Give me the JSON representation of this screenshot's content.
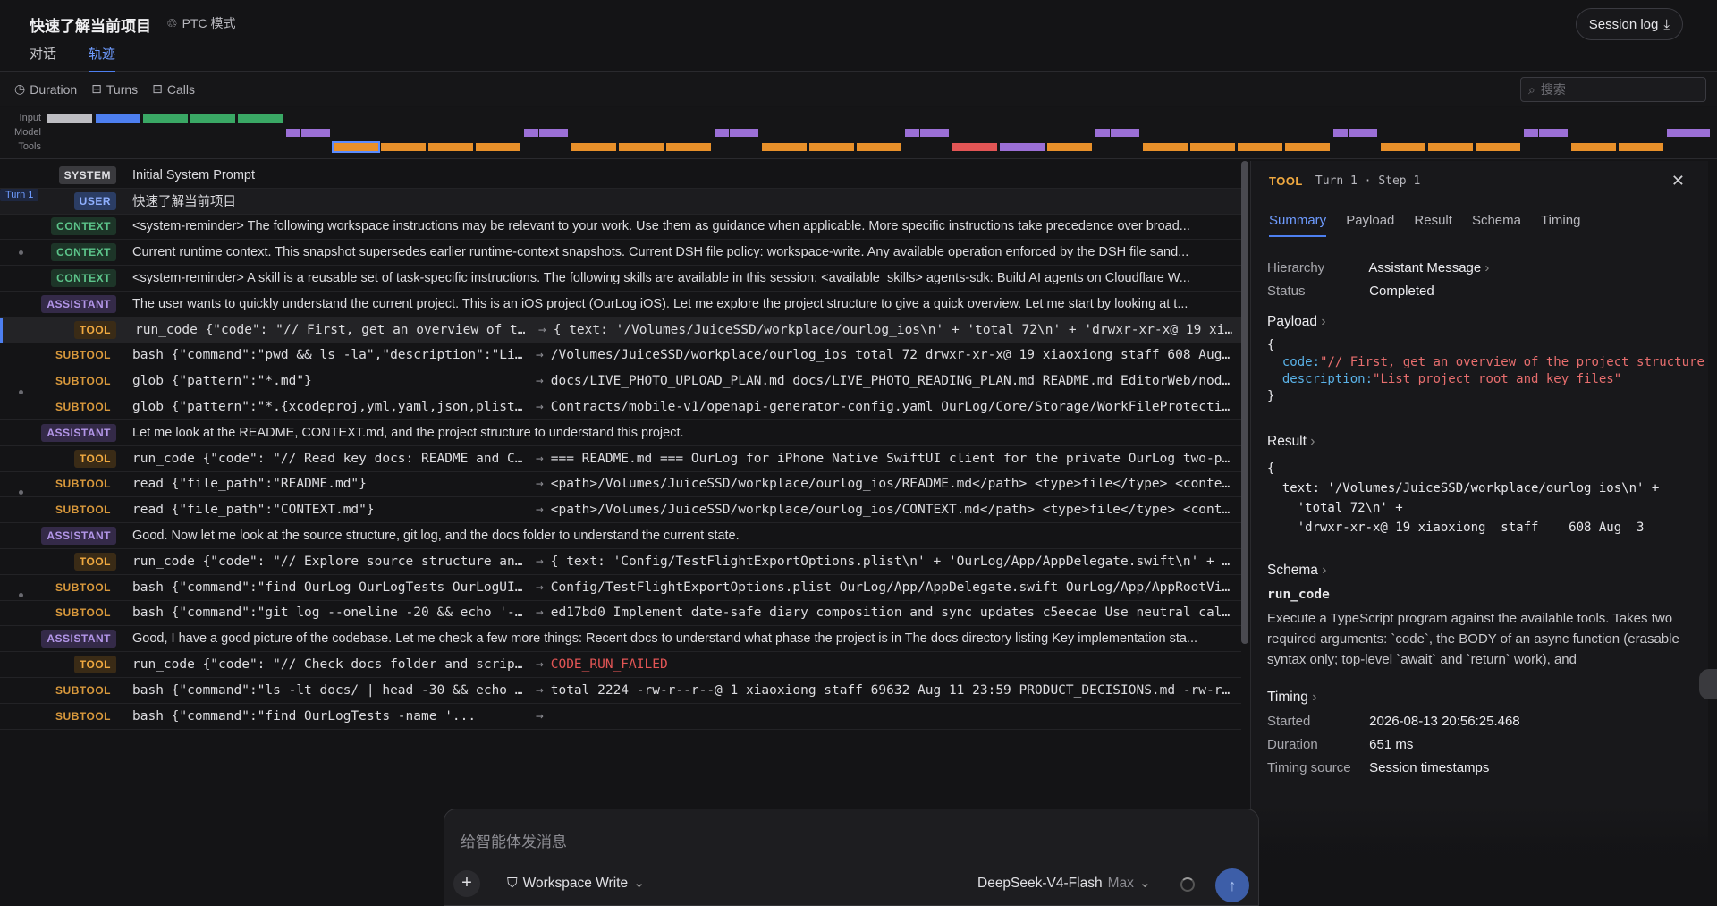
{
  "header": {
    "title": "快速了解当前项目",
    "mode": "PTC 模式",
    "tabs": [
      "对话",
      "轨迹"
    ],
    "session_log": "Session log"
  },
  "filters": {
    "duration": "Duration",
    "turns": "Turns",
    "calls": "Calls",
    "search_placeholder": "搜索"
  },
  "timeline": {
    "labels": [
      "Input",
      "Model",
      "Tools"
    ]
  },
  "turn_label": "Turn 1",
  "rows": [
    {
      "badge": "SYSTEM",
      "kind": "system",
      "text": "Initial System Prompt"
    },
    {
      "badge": "USER",
      "kind": "user",
      "text": "快速了解当前项目"
    },
    {
      "badge": "CONTEXT",
      "kind": "context",
      "text": "<system-reminder> The following workspace instructions may be relevant to your work. Use them as guidance when applicable. More specific instructions take precedence over broad..."
    },
    {
      "badge": "CONTEXT",
      "kind": "context",
      "text": "Current runtime context. This snapshot supersedes earlier runtime-context snapshots. Current DSH file policy: workspace-write. Any available operation enforced by the DSH file sand..."
    },
    {
      "badge": "CONTEXT",
      "kind": "context",
      "text": "<system-reminder> A skill is a reusable set of task-specific instructions. The following skills are available in this session: <available_skills> agents-sdk: Build AI agents on Cloudflare W..."
    },
    {
      "badge": "ASSISTANT",
      "kind": "assistant",
      "text": "The user wants to quickly understand the current project. This is an iOS project (OurLog iOS). Let me explore the project structure to give a quick overview. Let me start by looking at t..."
    },
    {
      "badge": "TOOL",
      "kind": "tool",
      "args": "run_code {\"code\": \"// First, get an overview of th...",
      "result": "{ text: '/Volumes/JuiceSSD/workplace/ourlog_ios\\n' + 'total 72\\n' + 'drwxr-xr-x@ 19 xiaox..."
    },
    {
      "badge": "SUBTOOL",
      "kind": "subtool",
      "args": "bash {\"command\":\"pwd && ls -la\",\"description\":\"Lis...",
      "result": "/Volumes/JuiceSSD/workplace/ourlog_ios total 72 drwxr-xr-x@ 19 xiaoxiong staff 608 Aug 3 ..."
    },
    {
      "badge": "SUBTOOL",
      "kind": "subtool",
      "args": "glob {\"pattern\":\"*.md\"}",
      "result": "docs/LIVE_PHOTO_UPLOAD_PLAN.md docs/LIVE_PHOTO_READING_PLAN.md README.md EditorWeb/node_m..."
    },
    {
      "badge": "SUBTOOL",
      "kind": "subtool",
      "args": "glob {\"pattern\":\"*.{xcodeproj,yml,yaml,json,plist,...",
      "result": "Contracts/mobile-v1/openapi-generator-config.yaml OurLog/Core/Storage/WorkFileProtection...."
    },
    {
      "badge": "ASSISTANT",
      "kind": "assistant",
      "text": "Let me look at the README, CONTEXT.md, and the project structure to understand this project."
    },
    {
      "badge": "TOOL",
      "kind": "tool",
      "args": "run_code {\"code\": \"// Read key docs: README and CO...",
      "result": "=== README.md === OurLog for iPhone Native SwiftUI client for the private OurLog two-pers..."
    },
    {
      "badge": "SUBTOOL",
      "kind": "subtool",
      "args": "read {\"file_path\":\"README.md\"}",
      "result": "<path>/Volumes/JuiceSSD/workplace/ourlog_ios/README.md</path> <type>file</type> <content>..."
    },
    {
      "badge": "SUBTOOL",
      "kind": "subtool",
      "args": "read {\"file_path\":\"CONTEXT.md\"}",
      "result": "<path>/Volumes/JuiceSSD/workplace/ourlog_ios/CONTEXT.md</path> <type>file</type> <content..."
    },
    {
      "badge": "ASSISTANT",
      "kind": "assistant",
      "text": "Good. Now let me look at the source structure, git log, and the docs folder to understand the current state."
    },
    {
      "badge": "TOOL",
      "kind": "tool",
      "args": "run_code {\"code\": \"// Explore source structure and...",
      "result": "{ text: 'Config/TestFlightExportOptions.plist\\n' + 'OurLog/App/AppDelegate.swift\\n' + 'Ou..."
    },
    {
      "badge": "SUBTOOL",
      "kind": "subtool",
      "args": "bash {\"command\":\"find OurLog OurLogTests OurLogUIT...",
      "result": "Config/TestFlightExportOptions.plist OurLog/App/AppDelegate.swift OurLog/App/AppRootView...."
    },
    {
      "badge": "SUBTOOL",
      "kind": "subtool",
      "args": "bash {\"command\":\"git log --oneline -20 && echo '--...",
      "result": "ed17bd0 Implement date-safe diary composition and sync updates c5eecae Use neutral calend..."
    },
    {
      "badge": "ASSISTANT",
      "kind": "assistant",
      "text": "Good, I have a good picture of the codebase. Let me check a few more things: Recent docs to understand what phase the project is in The docs directory listing Key implementation sta..."
    },
    {
      "badge": "TOOL",
      "kind": "tool",
      "args": "run_code {\"code\": \"// Check docs folder and script...",
      "result": "CODE_RUN_FAILED",
      "error": true
    },
    {
      "badge": "SUBTOOL",
      "kind": "subtool",
      "args": "bash {\"command\":\"ls -lt docs/ | head -30 && echo '...",
      "result": "total 2224 -rw-r--r--@ 1 xiaoxiong staff 69632 Aug 11 23:59 PRODUCT_DECISIONS.md -rw-r--r..."
    },
    {
      "badge": "SUBTOOL",
      "kind": "subtool",
      "args": "bash {\"command\":\"find OurLogTests -name '...",
      "result": ""
    }
  ],
  "detail": {
    "kind": "TOOL",
    "step": "Turn 1 · Step 1",
    "tabs": [
      "Summary",
      "Payload",
      "Result",
      "Schema",
      "Timing"
    ],
    "hierarchy_label": "Hierarchy",
    "hierarchy_value": "Assistant Message",
    "status_label": "Status",
    "status_value": "Completed",
    "payload_title": "Payload",
    "payload_open": "{",
    "payload_code_key": "code:",
    "payload_code_val": "\"// First, get an overview of the project structure",
    "payload_desc_key": "description:",
    "payload_desc_val": "\"List project root and key files\"",
    "payload_close": "}",
    "result_title": "Result",
    "result_lines": [
      "{",
      "  text: '/Volumes/JuiceSSD/workplace/ourlog_ios\\n' +",
      "    'total 72\\n' +",
      "    'drwxr-xr-x@ 19 xiaoxiong  staff    608 Aug  3"
    ],
    "schema_title": "Schema",
    "schema_name": "run_code",
    "schema_desc": "Execute a TypeScript program against the available tools. Takes two required arguments: `code`, the BODY of an async function (erasable syntax only; top-level `await` and `return` work), and",
    "timing_title": "Timing",
    "started_label": "Started",
    "started_value": "2026-08-13 20:56:25.468",
    "duration_label": "Duration",
    "duration_value": "651 ms",
    "source_label": "Timing source",
    "source_value": "Session timestamps"
  },
  "composer": {
    "placeholder": "给智能体发消息",
    "workspace": "Workspace Write",
    "model": "DeepSeek-V4-Flash",
    "model_tier": "Max"
  },
  "colors": {
    "accent": "#4d7ff0",
    "tool": "#f0a940",
    "model": "#9b6fd6",
    "error": "#e25555",
    "context": "#5cc48a"
  }
}
